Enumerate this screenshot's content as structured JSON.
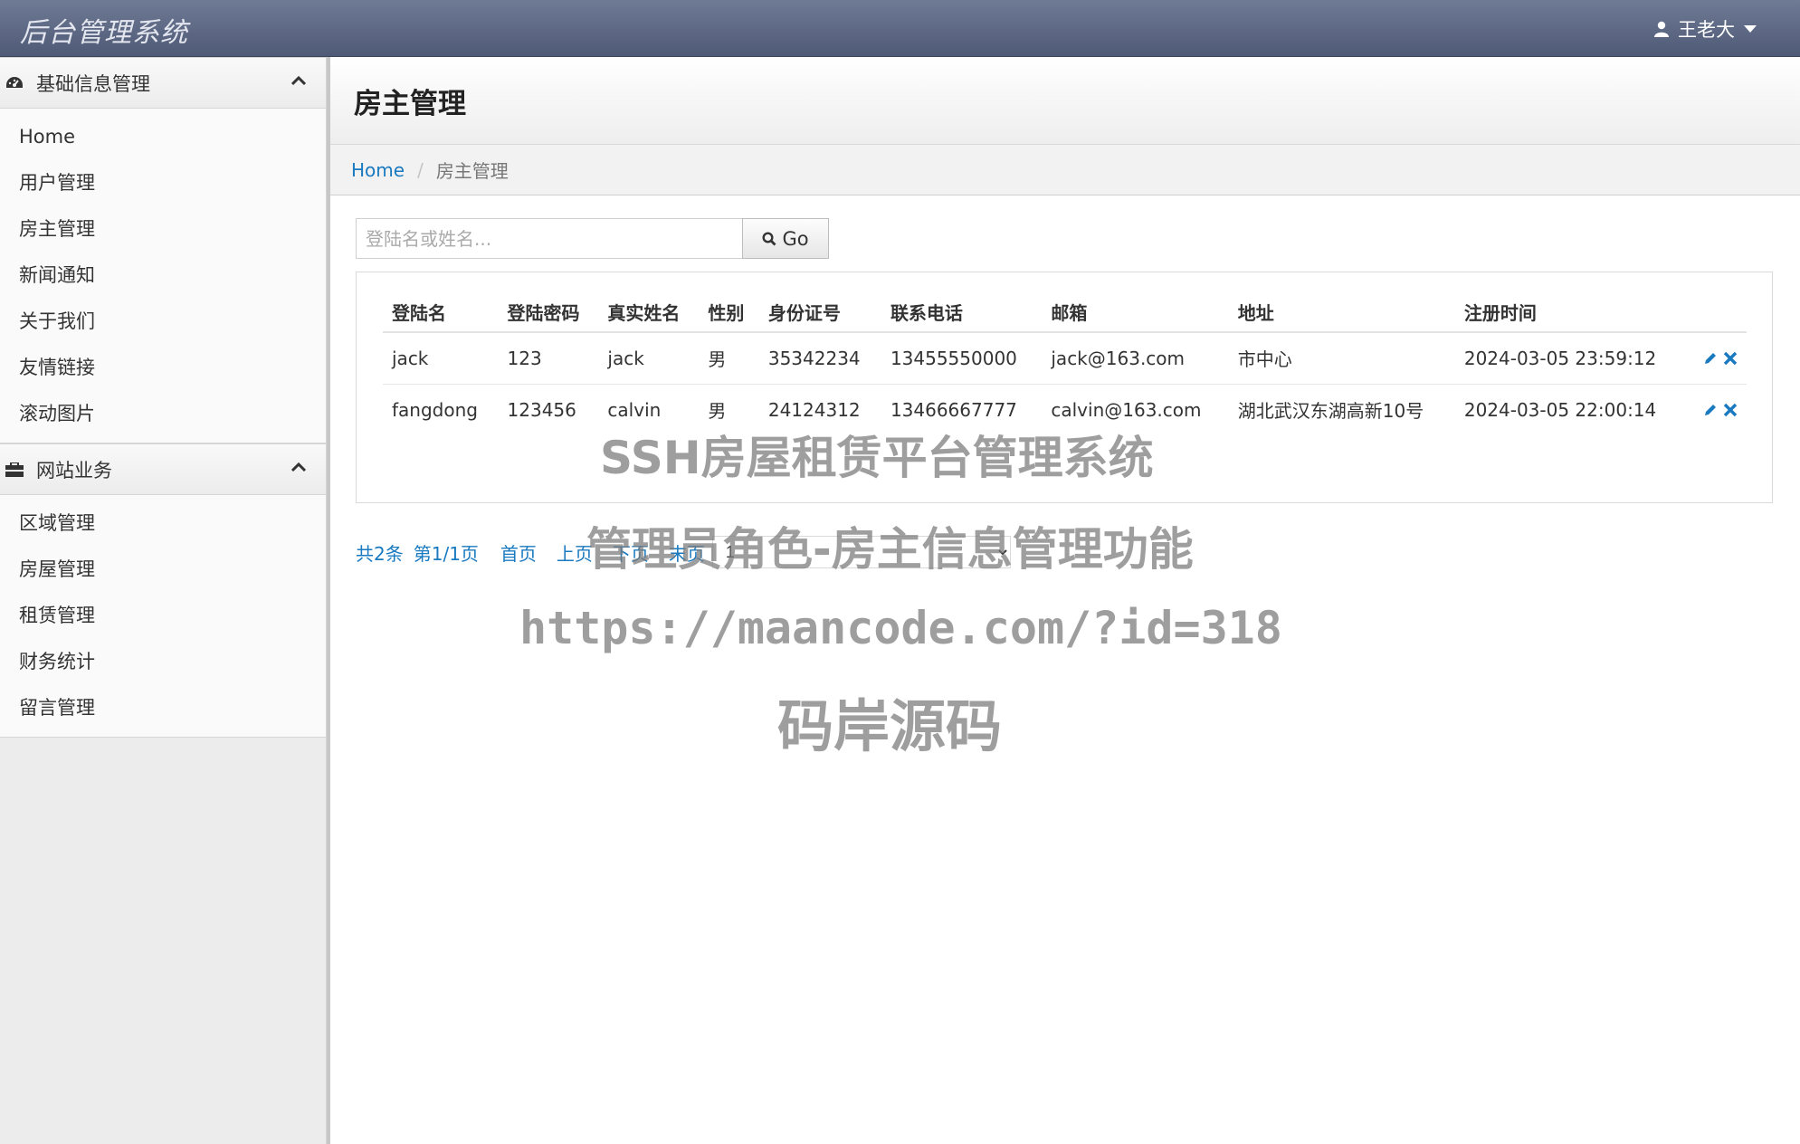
{
  "app": {
    "brand": "后台管理系统",
    "user": "王老大"
  },
  "sidebar": {
    "sections": [
      {
        "title": "基础信息管理",
        "icon": "dashboard-icon",
        "items": [
          "Home",
          "用户管理",
          "房主管理",
          "新闻通知",
          "关于我们",
          "友情链接",
          "滚动图片"
        ]
      },
      {
        "title": "网站业务",
        "icon": "briefcase-icon",
        "items": [
          "区域管理",
          "房屋管理",
          "租赁管理",
          "财务统计",
          "留言管理"
        ]
      }
    ]
  },
  "page": {
    "title": "房主管理"
  },
  "breadcrumb": {
    "home": "Home",
    "current": "房主管理"
  },
  "search": {
    "placeholder": "登陆名或姓名...",
    "button": "Go"
  },
  "table": {
    "headers": [
      "登陆名",
      "登陆密码",
      "真实姓名",
      "性别",
      "身份证号",
      "联系电话",
      "邮箱",
      "地址",
      "注册时间"
    ],
    "rows": [
      [
        "jack",
        "123",
        "jack",
        "男",
        "35342234",
        "13455550000",
        "jack@163.com",
        "市中心",
        "2024-03-05 23:59:12"
      ],
      [
        "fangdong",
        "123456",
        "calvin",
        "男",
        "24124312",
        "13466667777",
        "calvin@163.com",
        "湖北武汉东湖高新10号",
        "2024-03-05 22:00:14"
      ]
    ]
  },
  "pager": {
    "total": "共2条",
    "page": "第1/1页",
    "first": "首页",
    "prev": "上页",
    "next": "下页",
    "last": "末页",
    "select_value": "1"
  },
  "watermark": {
    "line1": "SSH房屋租赁平台管理系统",
    "line2": "管理员角色-房主信息管理功能",
    "line3": "https://maancode.com/?id=318",
    "line4": "码岸源码"
  },
  "colors": {
    "link": "#1a7ac0",
    "topbar": "#5c6783",
    "action": "#1a7ac0"
  }
}
